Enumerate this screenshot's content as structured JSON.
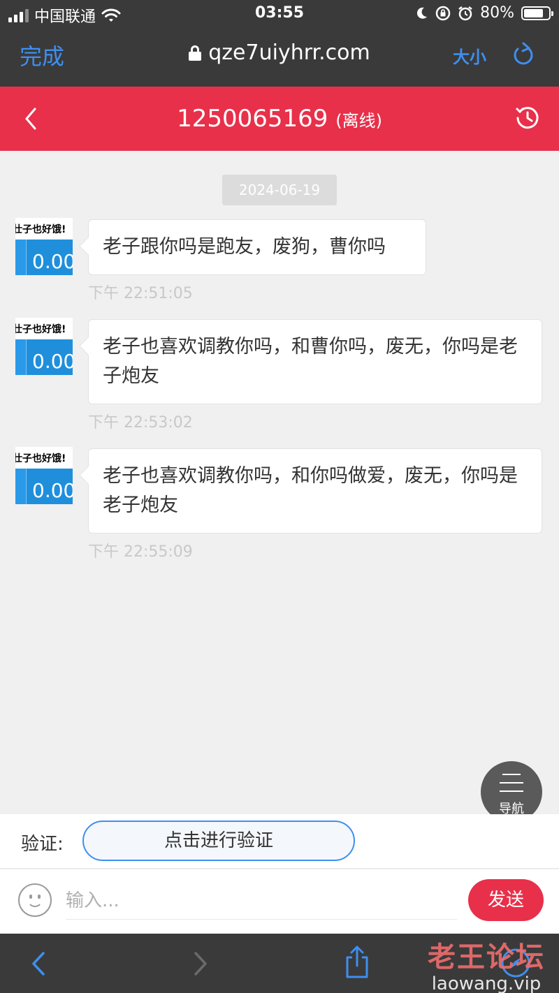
{
  "status_bar": {
    "carrier": "中国联通",
    "time": "03:55",
    "battery": "80%",
    "battery_level": 0.8
  },
  "browser": {
    "done_label": "完成",
    "url": "qze7uiyhrr.com",
    "font_size_label": "大小"
  },
  "chat": {
    "contact_id": "1250065169",
    "contact_status": "(离线)",
    "date": "2024-06-19",
    "avatar_text": "壮子也好饿!",
    "avatar_amount": "0.00",
    "messages": [
      {
        "text": "老子跟你吗是跑友，废狗，曹你吗",
        "time": "下午 22:51:05"
      },
      {
        "text": "老子也喜欢调教你吗，和曹你吗，废无，你吗是老子炮友",
        "time": "下午 22:53:02"
      },
      {
        "text": "老子也喜欢调教你吗，和你吗做爱，废无，你吗是老子炮友",
        "time": "下午 22:55:09"
      }
    ]
  },
  "nav_fab": {
    "label": "导航"
  },
  "verify": {
    "label": "验证:",
    "button": "点击进行验证"
  },
  "composer": {
    "placeholder": "输入...",
    "send_label": "发送"
  },
  "watermark": {
    "line1": "老王论坛",
    "line2": "laowang.vip"
  },
  "colors": {
    "accent_red": "#e8304a",
    "ios_blue": "#3d8ff0",
    "bar_dark": "#3a3a3a"
  }
}
